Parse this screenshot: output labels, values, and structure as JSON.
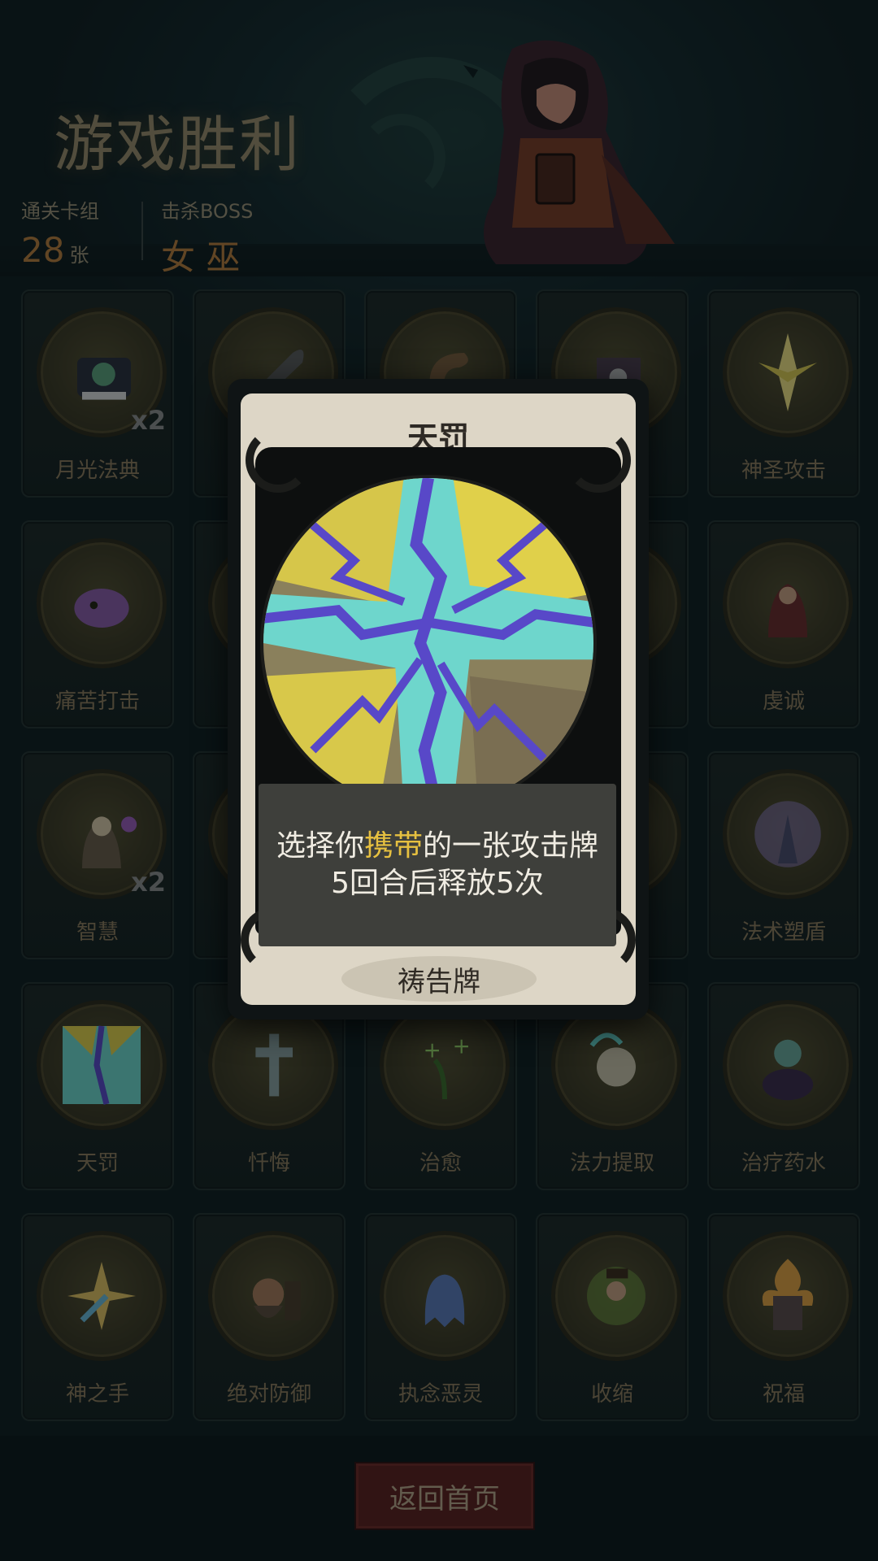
{
  "header": {
    "title": "游戏胜利",
    "cleared_deck_label": "通关卡组",
    "cleared_deck_value": "28",
    "cleared_deck_unit": "张",
    "boss_label": "击杀BOSS",
    "boss_value": "女 巫"
  },
  "cards": [
    {
      "name": "月光法典",
      "count": "x2",
      "icon": "tome-icon"
    },
    {
      "name": "",
      "count": "",
      "icon": "scythe-icon"
    },
    {
      "name": "",
      "count": "",
      "icon": "horn-icon"
    },
    {
      "name": "",
      "count": "",
      "icon": "skull-book-icon"
    },
    {
      "name": "神圣攻击",
      "count": "",
      "icon": "holy-strike-icon"
    },
    {
      "name": "痛苦打击",
      "count": "",
      "icon": "pain-skull-icon"
    },
    {
      "name": "",
      "count": "",
      "icon": "hidden-card-icon"
    },
    {
      "name": "",
      "count": "",
      "icon": "hidden-card-icon"
    },
    {
      "name": "",
      "count": "",
      "icon": "hidden-card-icon"
    },
    {
      "name": "虔诚",
      "count": "",
      "icon": "praying-monk-icon"
    },
    {
      "name": "智慧",
      "count": "x2",
      "icon": "sage-icon"
    },
    {
      "name": "",
      "count": "",
      "icon": "hidden-card-icon"
    },
    {
      "name": "",
      "count": "",
      "icon": "hidden-card-icon"
    },
    {
      "name": "",
      "count": "",
      "icon": "hidden-card-icon"
    },
    {
      "name": "法术塑盾",
      "count": "",
      "icon": "spell-shield-icon"
    },
    {
      "name": "天罚",
      "count": "",
      "icon": "lightning-icon"
    },
    {
      "name": "忏悔",
      "count": "",
      "icon": "cross-icon"
    },
    {
      "name": "治愈",
      "count": "",
      "icon": "heal-sprout-icon"
    },
    {
      "name": "法力提取",
      "count": "",
      "icon": "mana-skull-icon"
    },
    {
      "name": "治疗药水",
      "count": "",
      "icon": "potion-icon"
    },
    {
      "name": "神之手",
      "count": "",
      "icon": "god-hand-icon"
    },
    {
      "name": "绝对防御",
      "count": "",
      "icon": "dwarf-shield-icon"
    },
    {
      "name": "执念恶灵",
      "count": "",
      "icon": "ghost-icon"
    },
    {
      "name": "收缩",
      "count": "",
      "icon": "shrink-icon"
    },
    {
      "name": "祝福",
      "count": "",
      "icon": "blessing-knight-icon"
    }
  ],
  "modal": {
    "title": "天罚",
    "desc_prefix": "选择你",
    "desc_highlight": "携带",
    "desc_suffix": "的一张攻击牌",
    "desc_line2": "5回合后释放5次",
    "type": "祷告牌",
    "highlight_color": "#e6c040"
  },
  "footer": {
    "home_button": "返回首页"
  }
}
